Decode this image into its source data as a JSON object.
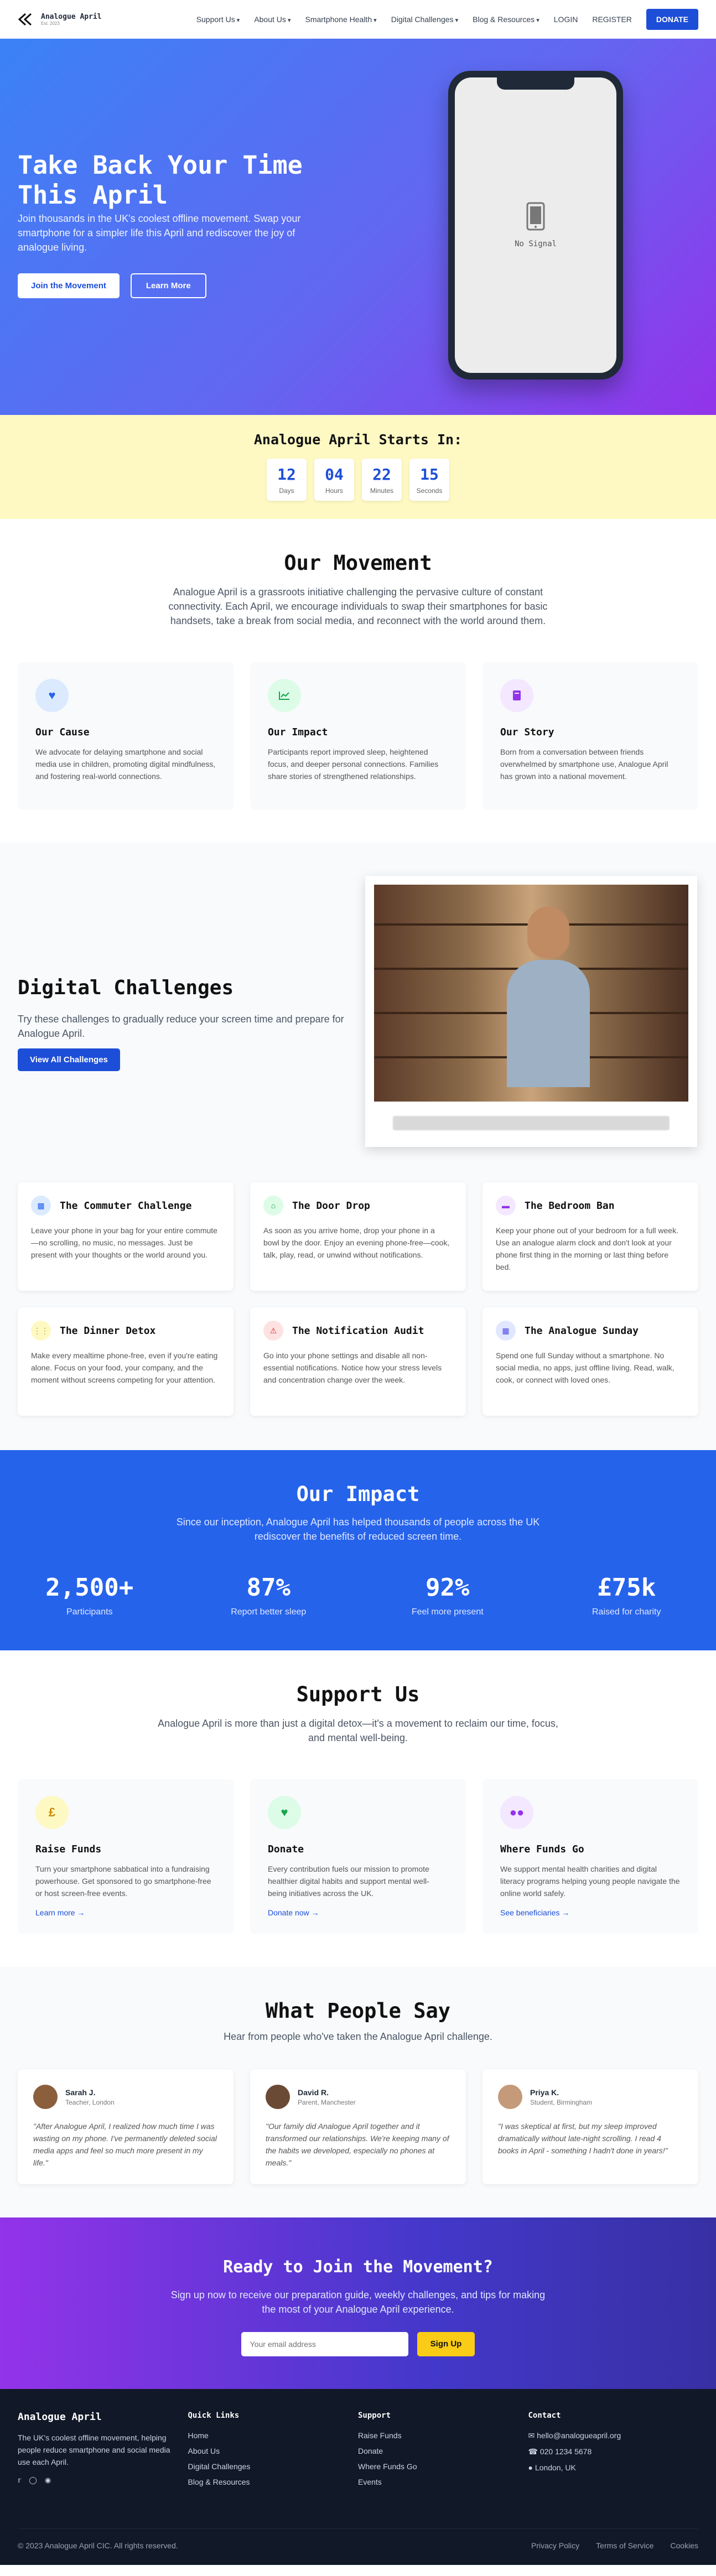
{
  "nav": {
    "logo_title": "Analogue April",
    "logo_sub": "Est. 2023",
    "items": [
      "Support Us",
      "About Us",
      "Smartphone Health",
      "Digital Challenges",
      "Blog & Resources"
    ],
    "login": "LOGIN",
    "register": "REGISTER",
    "donate": "DONATE"
  },
  "hero": {
    "title": "Take Back Your Time This April",
    "subtitle": "Join thousands in the UK's coolest offline movement. Swap your smartphone for a simpler life this April and rediscover the joy of analogue living.",
    "btn_join": "Join the Movement",
    "btn_learn": "Learn More",
    "phone_text": "No Signal"
  },
  "countdown": {
    "title": "Analogue April Starts In:",
    "units": [
      {
        "n": "12",
        "l": "Days"
      },
      {
        "n": "04",
        "l": "Hours"
      },
      {
        "n": "22",
        "l": "Minutes"
      },
      {
        "n": "15",
        "l": "Seconds"
      }
    ]
  },
  "movement": {
    "title": "Our Movement",
    "text": "Analogue April is a grassroots initiative challenging the pervasive culture of constant connectivity. Each April, we encourage individuals to swap their smartphones for basic handsets, take a break from social media, and reconnect with the world around them.",
    "cards": [
      {
        "title": "Our Cause",
        "text": "We advocate for delaying smartphone and social media use in children, promoting digital mindfulness, and fostering real-world connections."
      },
      {
        "title": "Our Impact",
        "text": "Participants report improved sleep, heightened focus, and deeper personal connections. Families share stories of strengthened relationships."
      },
      {
        "title": "Our Story",
        "text": "Born from a conversation between friends overwhelmed by smartphone use, Analogue April has grown into a national movement."
      }
    ]
  },
  "challenges": {
    "title": "Digital Challenges",
    "text": "Try these challenges to gradually reduce your screen time and prepare for Analogue April.",
    "btn": "View All Challenges",
    "items": [
      {
        "title": "The Commuter Challenge",
        "text": "Leave your phone in your bag for your entire commute—no scrolling, no music, no messages. Just be present with your thoughts or the world around you."
      },
      {
        "title": "The Door Drop",
        "text": "As soon as you arrive home, drop your phone in a bowl by the door. Enjoy an evening phone-free—cook, talk, play, read, or unwind without notifications."
      },
      {
        "title": "The Bedroom Ban",
        "text": "Keep your phone out of your bedroom for a full week. Use an analogue alarm clock and don't look at your phone first thing in the morning or last thing before bed."
      },
      {
        "title": "The Dinner Detox",
        "text": "Make every mealtime phone-free, even if you're eating alone. Focus on your food, your company, and the moment without screens competing for your attention."
      },
      {
        "title": "The Notification Audit",
        "text": "Go into your phone settings and disable all non-essential notifications. Notice how your stress levels and concentration change over the week."
      },
      {
        "title": "The Analogue Sunday",
        "text": "Spend one full Sunday without a smartphone. No social media, no apps, just offline living. Read, walk, cook, or connect with loved ones."
      }
    ]
  },
  "impact": {
    "title": "Our Impact",
    "text": "Since our inception, Analogue April has helped thousands of people across the UK rediscover the benefits of reduced screen time.",
    "stats": [
      {
        "v": "2,500+",
        "l": "Participants"
      },
      {
        "v": "87%",
        "l": "Report better sleep"
      },
      {
        "v": "92%",
        "l": "Feel more present"
      },
      {
        "v": "£75k",
        "l": "Raised for charity"
      }
    ]
  },
  "support": {
    "title": "Support Us",
    "text": "Analogue April is more than just a digital detox—it's a movement to reclaim our time, focus, and mental well-being.",
    "cards": [
      {
        "title": "Raise Funds",
        "text": "Turn your smartphone sabbatical into a fundraising powerhouse. Get sponsored to go smartphone-free or host screen-free events.",
        "link": "Learn more →"
      },
      {
        "title": "Donate",
        "text": "Every contribution fuels our mission to promote healthier digital habits and support mental well-being initiatives across the UK.",
        "link": "Donate now →"
      },
      {
        "title": "Where Funds Go",
        "text": "We support mental health charities and digital literacy programs helping young people navigate the online world safely.",
        "link": "See beneficiaries →"
      }
    ]
  },
  "testimonials": {
    "title": "What People Say",
    "text": "Hear from people who've taken the Analogue April challenge.",
    "items": [
      {
        "name": "Sarah J.",
        "role": "Teacher, London",
        "quote": "\"After Analogue April, I realized how much time I was wasting on my phone. I've permanently deleted social media apps and feel so much more present in my life.\""
      },
      {
        "name": "David R.",
        "role": "Parent, Manchester",
        "quote": "\"Our family did Analogue April together and it transformed our relationships. We're keeping many of the habits we developed, especially no phones at meals.\""
      },
      {
        "name": "Priya K.",
        "role": "Student, Birmingham",
        "quote": "\"I was skeptical at first, but my sleep improved dramatically without late-night scrolling. I read 4 books in April - something I hadn't done in years!\""
      }
    ]
  },
  "cta": {
    "title": "Ready to Join the Movement?",
    "text": "Sign up now to receive our preparation guide, weekly challenges, and tips for making the most of your Analogue April experience.",
    "placeholder": "Your email address",
    "btn": "Sign Up"
  },
  "footer": {
    "brand": "Analogue April",
    "desc": "The UK's coolest offline movement, helping people reduce smartphone and social media use each April.",
    "quick_title": "Quick Links",
    "quick": [
      "Home",
      "About Us",
      "Digital Challenges",
      "Blog & Resources"
    ],
    "support_title": "Support",
    "support": [
      "Raise Funds",
      "Donate",
      "Where Funds Go",
      "Events"
    ],
    "contact_title": "Contact",
    "email": "hello@analogueapril.org",
    "phone": "020 1234 5678",
    "location": "London, UK",
    "copyright": "© 2023 Analogue April CIC. All rights reserved.",
    "links": [
      "Privacy Policy",
      "Terms of Service",
      "Cookies"
    ]
  }
}
